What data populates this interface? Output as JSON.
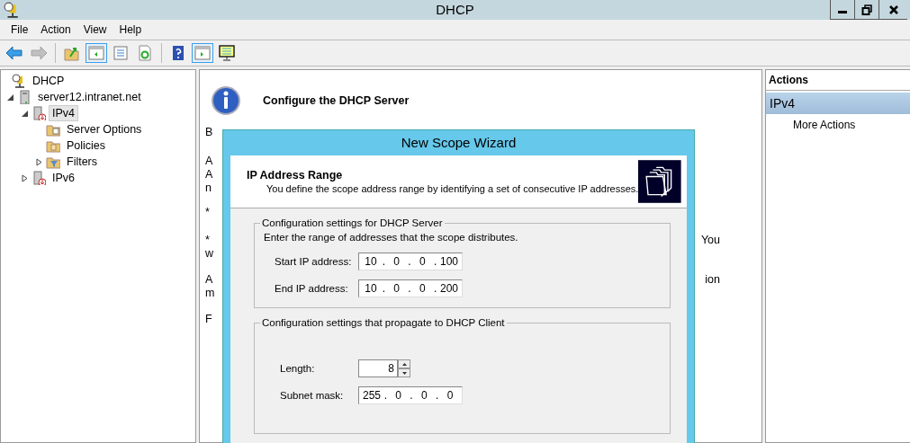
{
  "window": {
    "title": "DHCP"
  },
  "menu": [
    "File",
    "Action",
    "View",
    "Help"
  ],
  "toolbar": [
    {
      "kind": "back",
      "pressed": false,
      "disabled": false
    },
    {
      "kind": "forward",
      "pressed": false,
      "disabled": true
    },
    {
      "kind": "sep"
    },
    {
      "kind": "up",
      "pressed": false,
      "disabled": false
    },
    {
      "kind": "tree",
      "pressed": true,
      "disabled": false
    },
    {
      "kind": "list",
      "pressed": false,
      "disabled": false
    },
    {
      "kind": "refresh",
      "pressed": false,
      "disabled": false
    },
    {
      "kind": "sep"
    },
    {
      "kind": "help",
      "pressed": false,
      "disabled": false
    },
    {
      "kind": "pane",
      "pressed": true,
      "disabled": false
    },
    {
      "kind": "monitor",
      "pressed": false,
      "disabled": false
    }
  ],
  "tree": [
    {
      "label": "DHCP",
      "kind": "root",
      "selected": false,
      "children": [
        {
          "label": "server12.intranet.net",
          "kind": "server",
          "selected": false,
          "expanded": true,
          "children": [
            {
              "label": "IPv4",
              "kind": "protocol",
              "selected": true,
              "expanded": true,
              "children": [
                {
                  "label": "Server Options",
                  "kind": "options",
                  "selected": false
                },
                {
                  "label": "Policies",
                  "kind": "policies",
                  "selected": false
                },
                {
                  "label": "Filters",
                  "kind": "filters",
                  "selected": false,
                  "expanded": false
                }
              ]
            },
            {
              "label": "IPv6",
              "kind": "protocol",
              "selected": false,
              "expanded": false
            }
          ]
        }
      ]
    }
  ],
  "content": {
    "title": "Configure the DHCP Server",
    "lines": [
      {
        "left": "B"
      },
      {
        "left": "A"
      },
      {
        "left": "A"
      },
      {
        "left": "n"
      },
      {
        "left": "*"
      },
      {
        "left": "*",
        "right": "You"
      },
      {
        "left": "w"
      },
      {
        "left": "A",
        "right": "ion"
      },
      {
        "left": "m"
      },
      {
        "left": "F"
      }
    ]
  },
  "actions": {
    "header": "Actions",
    "items": [
      {
        "label": "IPv4",
        "selected": true
      },
      {
        "label": "More Actions",
        "selected": false
      }
    ]
  },
  "wizard": {
    "title": "New Scope Wizard",
    "heading": "IP Address Range",
    "subtitle": "You define the scope address range by identifying a set of consecutive IP addresses.",
    "groups": [
      {
        "legend": "Configuration settings for DHCP Server",
        "text": "Enter the range of addresses that the scope distributes.",
        "fields": [
          {
            "kind": "ip",
            "label": "Start IP address:",
            "octets": [
              "10",
              "0",
              "0",
              "100"
            ]
          },
          {
            "kind": "ip",
            "label": "End IP address:",
            "octets": [
              "10",
              "0",
              "0",
              "200"
            ]
          }
        ]
      },
      {
        "legend": "Configuration settings that propagate to DHCP Client",
        "fields": [
          {
            "kind": "spin",
            "label": "Length:",
            "value": "8"
          },
          {
            "kind": "ip",
            "label": "Subnet mask:",
            "octets": [
              "255",
              "0",
              "0",
              "0"
            ]
          }
        ]
      }
    ],
    "separator": "."
  }
}
